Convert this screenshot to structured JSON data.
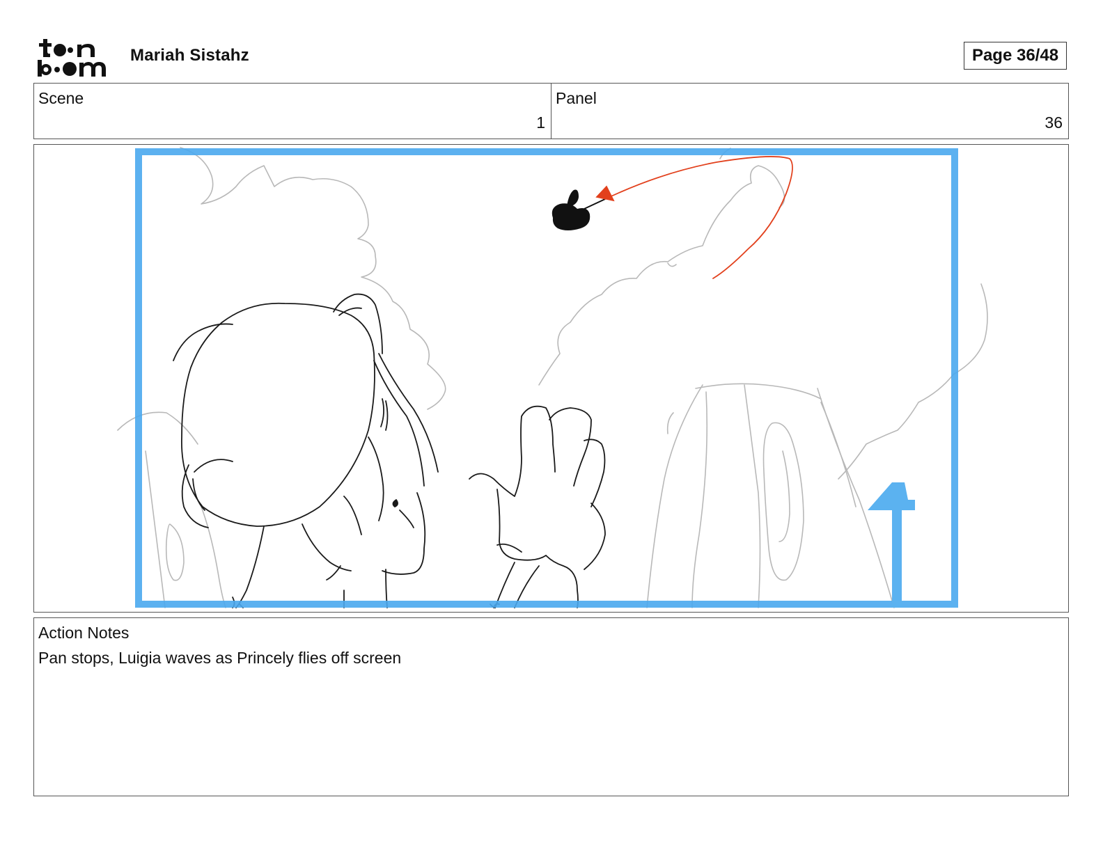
{
  "header": {
    "logo_text": "toon boom",
    "project_title": "Mariah Sistahz",
    "page_indicator": "Page 36/48"
  },
  "info": {
    "scene_label": "Scene",
    "scene_value": "1",
    "panel_label": "Panel",
    "panel_value": "36"
  },
  "panel_image": {
    "frame_color": "#4aa8ee",
    "camera_move": "up",
    "trajectory_color": "#e2401c"
  },
  "action_notes": {
    "label": "Action Notes",
    "text": "Pan stops, Luigia waves as Princely flies off screen"
  }
}
